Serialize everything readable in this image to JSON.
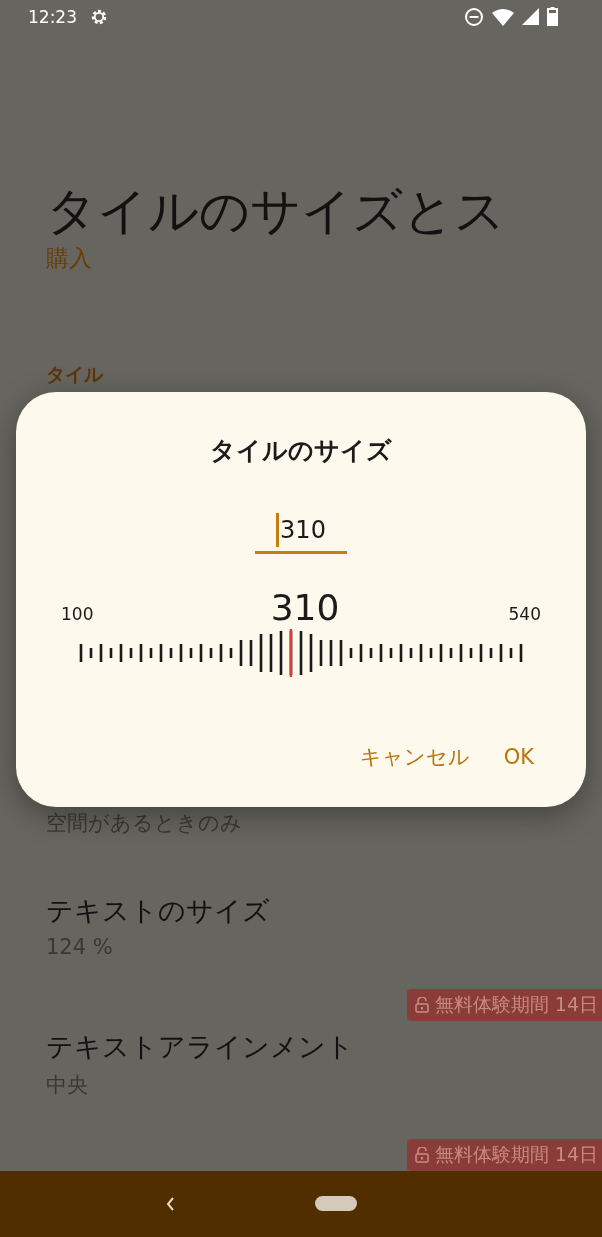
{
  "status_bar": {
    "time": "12:23"
  },
  "header": {
    "title": "タイルのサイズとス",
    "subtitle": "購入"
  },
  "section": {
    "title": "タイル"
  },
  "items": [
    {
      "summary": "空間があるときのみ"
    },
    {
      "title": "テキストのサイズ",
      "summary": "124 %"
    },
    {
      "badge": "無料体験期間 14日",
      "title": "テキストアラインメント",
      "summary": "中央"
    }
  ],
  "trailing_badge": "無料体験期間 14日",
  "dialog": {
    "title": "タイルのサイズ",
    "input_value": "310",
    "slider": {
      "min_label": "100",
      "max_label": "540",
      "reading": "310",
      "level": 0.477
    },
    "buttons": [
      {
        "label": "キャンセル"
      },
      {
        "label": "OK"
      }
    ]
  }
}
